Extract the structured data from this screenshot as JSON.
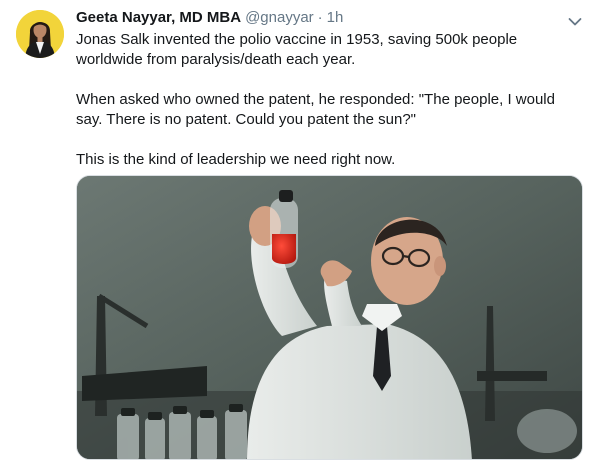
{
  "author": {
    "name": "Geeta Nayyar, MD MBA",
    "handle": "@gnayyar",
    "separator": "·",
    "time": "1h"
  },
  "tweet": {
    "paragraphs": [
      "Jonas Salk invented the polio vaccine in 1953, saving 500k people worldwide from paralysis/death each year.",
      "When asked who owned the patent, he responded: \"The people, I would say. There is no patent. Could you patent the sun?\"",
      "This is the kind of leadership we need right now."
    ]
  },
  "icons": {
    "menu": "chevron-down-icon"
  },
  "colors": {
    "text": "#14171a",
    "secondary": "#657786",
    "avatar_bg": "#f2d43a"
  }
}
